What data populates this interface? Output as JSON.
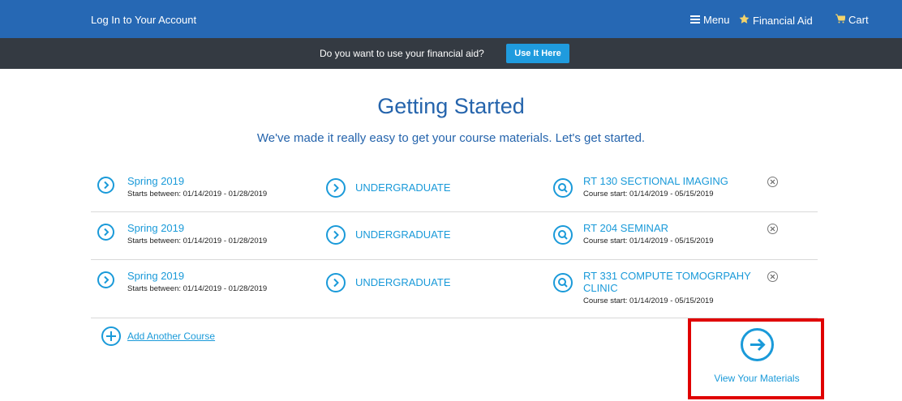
{
  "header": {
    "login": "Log In to Your Account",
    "menu": "Menu",
    "financial_aid": "Financial Aid",
    "cart": "Cart"
  },
  "aid_banner": {
    "question": "Do you want to use your financial aid?",
    "button": "Use It Here"
  },
  "page": {
    "title": "Getting Started",
    "subtitle": "We've made it really easy to get your course materials. Let's get started."
  },
  "rows": [
    {
      "term": "Spring 2019",
      "term_dates": "Starts between: 01/14/2019 - 01/28/2019",
      "level": "UNDERGRADUATE",
      "course": "RT 130 SECTIONAL IMAGING",
      "course_dates": "Course start: 01/14/2019 - 05/15/2019"
    },
    {
      "term": "Spring 2019",
      "term_dates": "Starts between: 01/14/2019 - 01/28/2019",
      "level": "UNDERGRADUATE",
      "course": "RT 204 SEMINAR",
      "course_dates": "Course start: 01/14/2019 - 05/15/2019"
    },
    {
      "term": "Spring 2019",
      "term_dates": "Starts between: 01/14/2019 - 01/28/2019",
      "level": "UNDERGRADUATE",
      "course": "RT 331 COMPUTE TOMOGRPAHY CLINIC",
      "course_dates": "Course start: 01/14/2019 - 05/15/2019"
    }
  ],
  "actions": {
    "add_course": "Add Another Course",
    "view_materials": "View Your Materials"
  },
  "colors": {
    "header_bg": "#2668b4",
    "banner_bg": "#343a42",
    "accent": "#1a9ad9",
    "title": "#2564ac",
    "highlight": "#e00000"
  },
  "icons": {
    "menu": "hamburger-icon",
    "financial_aid": "star-icon",
    "cart": "cart-icon",
    "term": "chevron-right-circle-icon",
    "level": "chevron-right-circle-icon",
    "course": "search-circle-icon",
    "remove": "close-circle-icon",
    "add": "plus-circle-icon",
    "view": "arrow-right-circle-icon"
  }
}
